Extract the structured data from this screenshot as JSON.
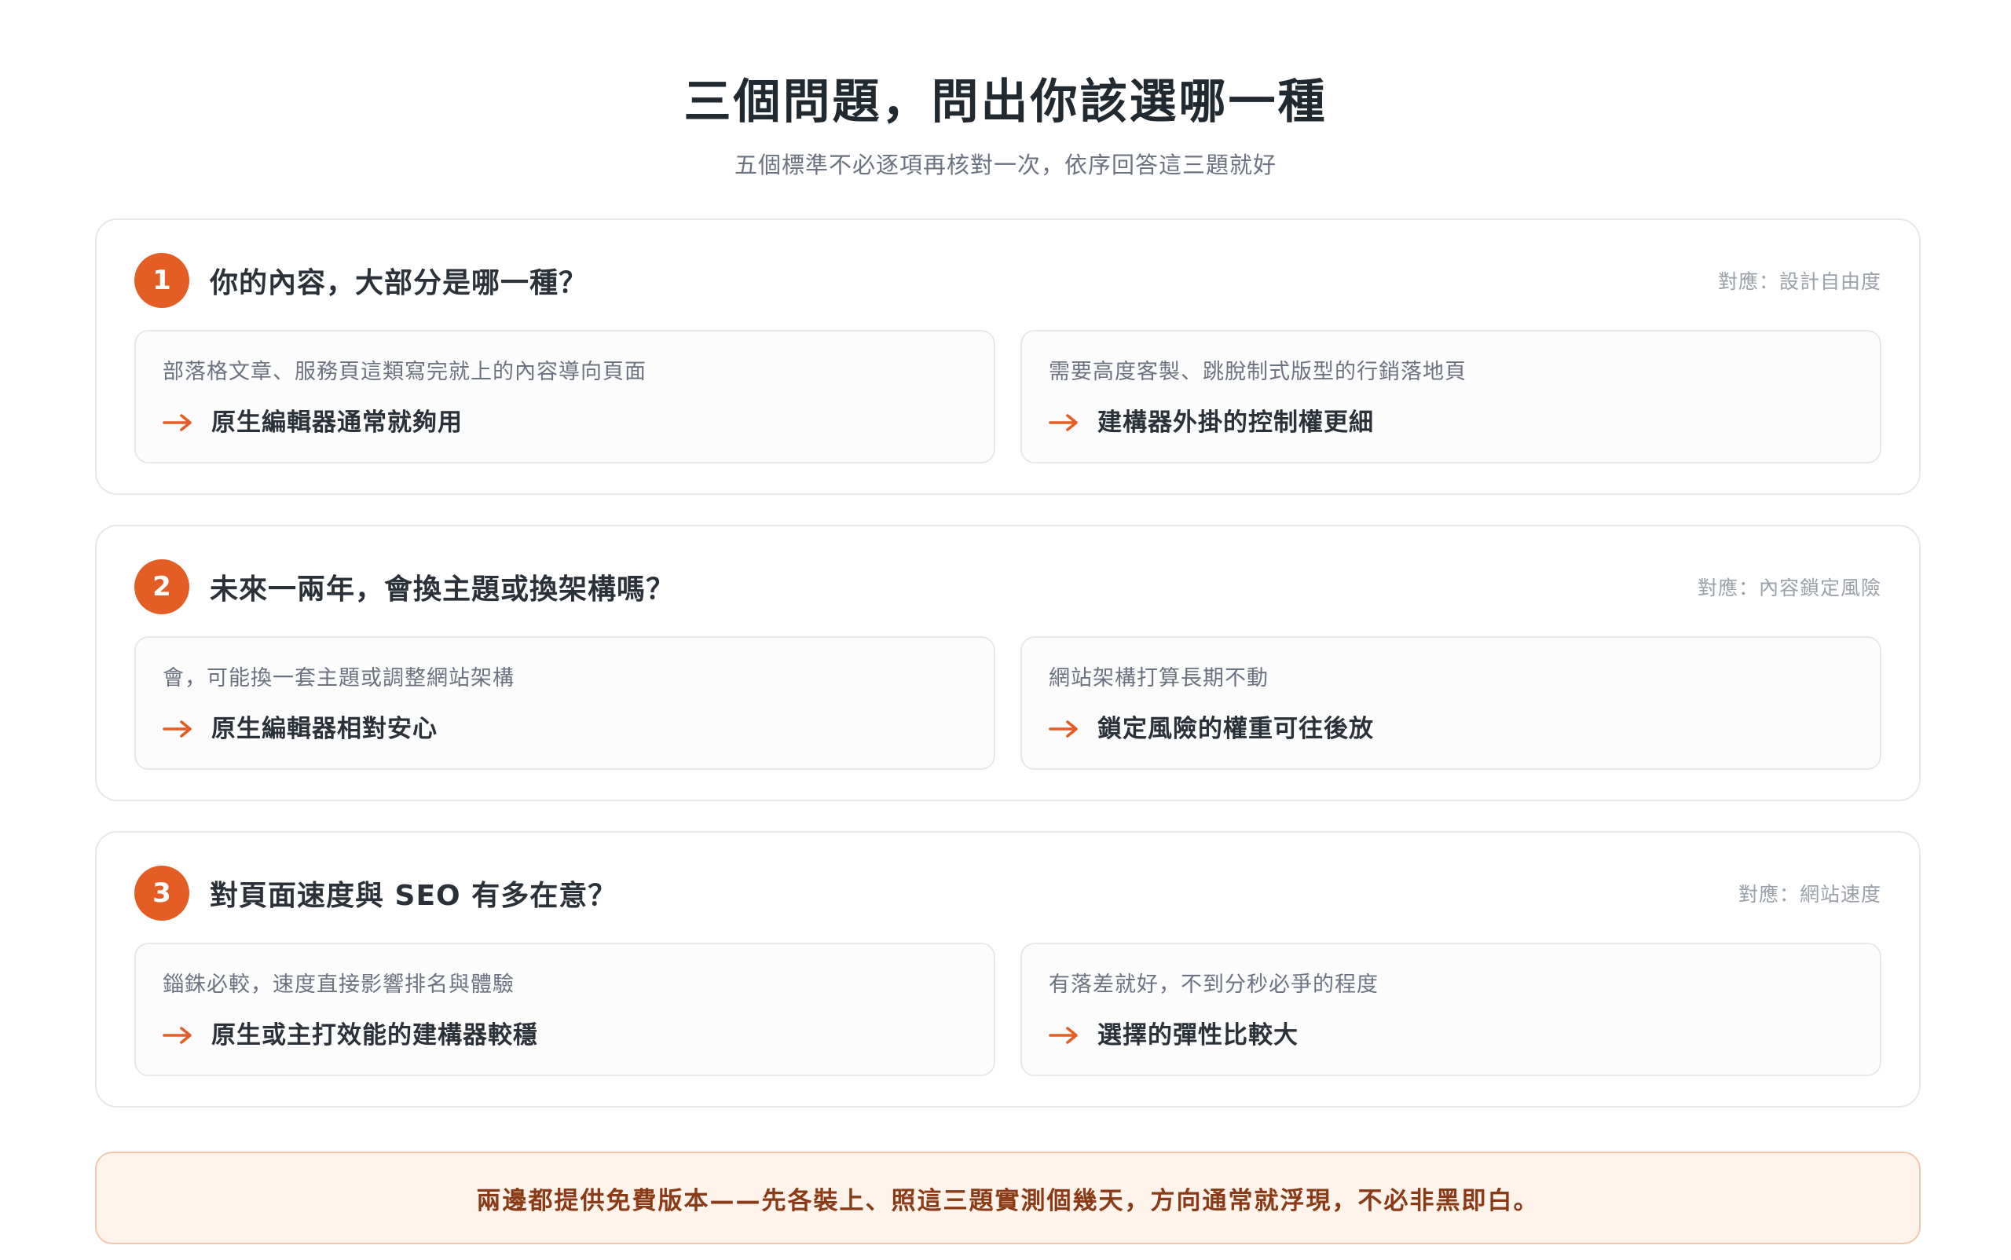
{
  "header": {
    "title": "三個問題，問出你該選哪一種",
    "subtitle": "五個標準不必逐項再核對一次，依序回答這三題就好"
  },
  "colors": {
    "accent": "#e35d24",
    "note_background": "#fff4ec",
    "note_text": "#8a3a14"
  },
  "questions": [
    {
      "number": "1",
      "question": "你的內容，大部分是哪一種？",
      "maps_to": "對應：設計自由度",
      "options": [
        {
          "condition": "部落格文章、服務頁這類寫完就上的內容導向頁面",
          "result": "原生編輯器通常就夠用"
        },
        {
          "condition": "需要高度客製、跳脫制式版型的行銷落地頁",
          "result": "建構器外掛的控制權更細"
        }
      ]
    },
    {
      "number": "2",
      "question": "未來一兩年，會換主題或換架構嗎？",
      "maps_to": "對應：內容鎖定風險",
      "options": [
        {
          "condition": "會，可能換一套主題或調整網站架構",
          "result": "原生編輯器相對安心"
        },
        {
          "condition": "網站架構打算長期不動",
          "result": "鎖定風險的權重可往後放"
        }
      ]
    },
    {
      "number": "3",
      "question": "對頁面速度與 SEO 有多在意？",
      "maps_to": "對應：網站速度",
      "options": [
        {
          "condition": "錙銖必較，速度直接影響排名與體驗",
          "result": "原生或主打效能的建構器較穩"
        },
        {
          "condition": "有落差就好，不到分秒必爭的程度",
          "result": "選擇的彈性比較大"
        }
      ]
    }
  ],
  "note": {
    "text": "兩邊都提供免費版本——先各裝上、照這三題實測個幾天，方向通常就浮現，不必非黑即白。"
  }
}
